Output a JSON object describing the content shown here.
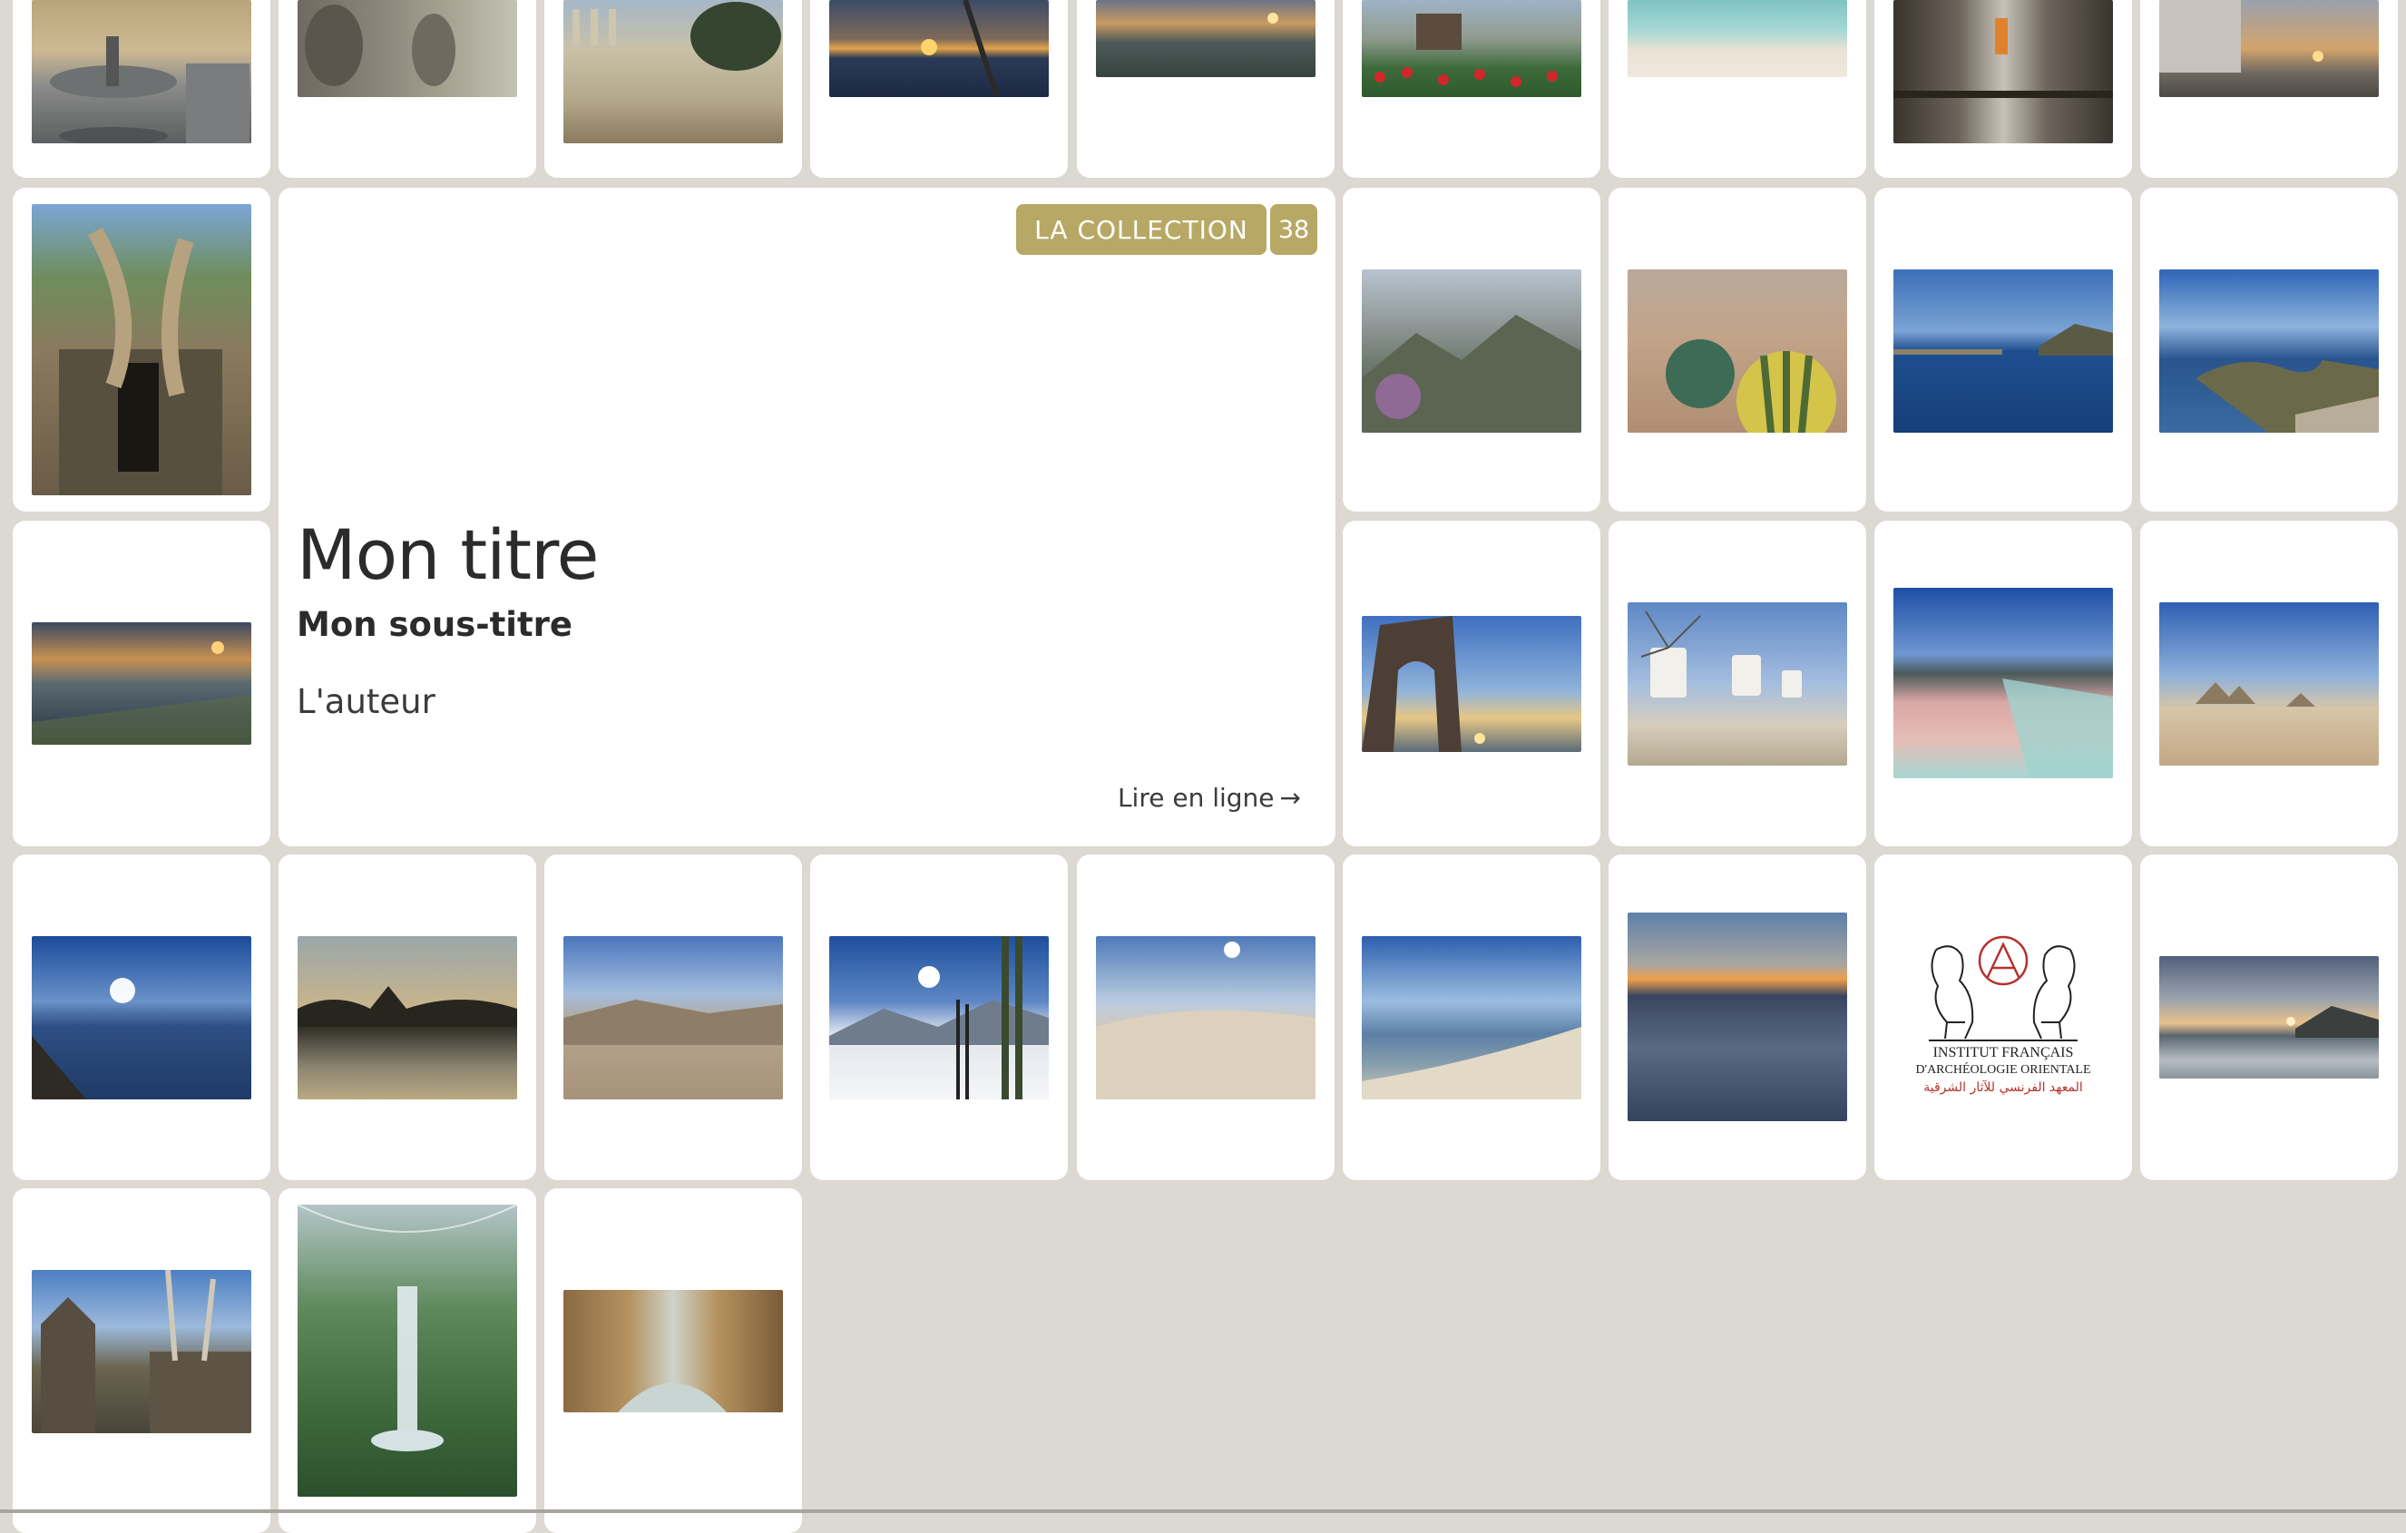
{
  "collection": {
    "badge_label": "LA COLLECTION",
    "count": "38",
    "title": "Mon titre",
    "subtitle": "Mon sous-titre",
    "author": "L'auteur",
    "read_link": "Lire en ligne",
    "read_link_arrow": "→"
  },
  "logo": {
    "line1": "INSTITUT  FRANÇAIS",
    "line2": "D'ARCHÉOLOGIE ORIENTALE",
    "line3": "المعهد الفرنسي للآثار الشرقية"
  },
  "colors": {
    "page_bg": "#dcd8d2",
    "card_bg": "#ffffff",
    "badge_bg": "#b7a865",
    "text": "#2b2b2b",
    "logo_red": "#b5322c"
  },
  "photo_subjects": [
    "fountain-plaza",
    "stone-faces-temple",
    "greek-ruins-tree",
    "sunset-over-sea",
    "coast-sunset",
    "temple-with-red-flowers",
    "white-sand-beach",
    "monk-in-corridor",
    "building-at-sunset",
    "tree-roots-temple",
    "sunset-beach",
    "monastery-cliffs",
    "hot-air-balloons",
    "calm-lake",
    "island-bay",
    "stone-arch-sunset",
    "windmills",
    "pink-beach",
    "pyramids",
    "sun-over-lake",
    "temple-reflection",
    "desert-valley",
    "snowy-mountain-skis",
    "sand-dune",
    "beach-shoreline",
    "above-clouds",
    "institute-logo",
    "cloudy-coast-sunset",
    "temple-ruins-trees",
    "indoor-waterfall",
    "river-canyon"
  ]
}
